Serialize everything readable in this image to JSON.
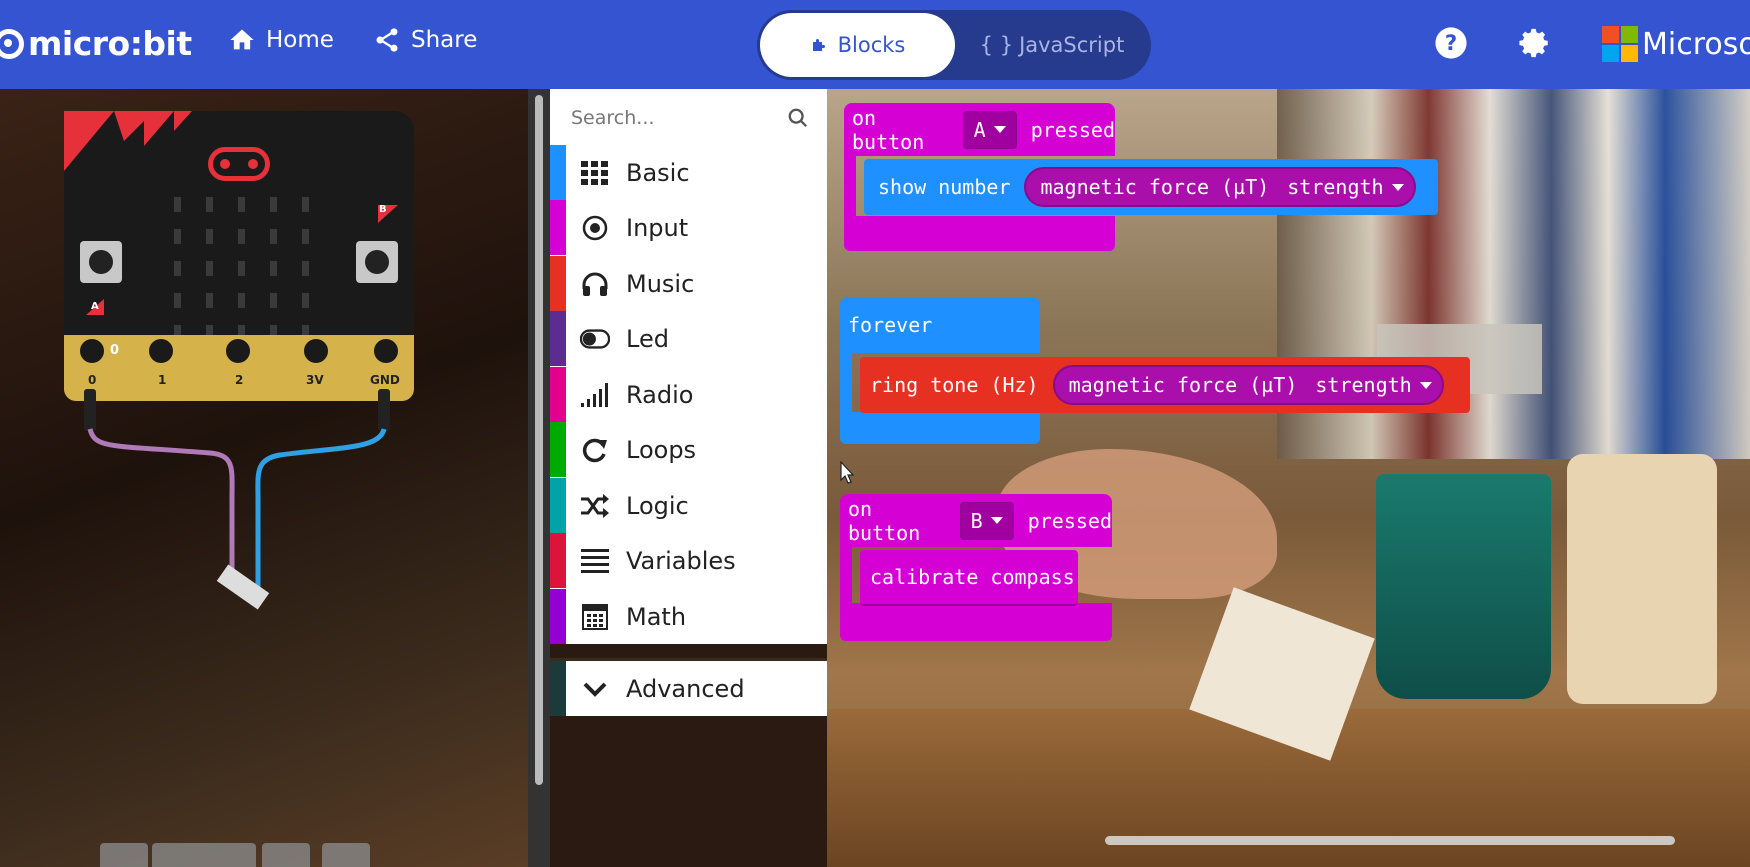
{
  "header": {
    "logo_text": "micro:bit",
    "home_label": "Home",
    "share_label": "Share",
    "blocks_label": "Blocks",
    "javascript_label": "JavaScript",
    "microsoft_label": "Microsoft",
    "icons": [
      "home-icon",
      "share-icon",
      "puzzle-icon",
      "code-braces-icon",
      "help-icon",
      "gear-icon",
      "microsoft-logo"
    ],
    "brand_color": "#3454d1"
  },
  "simulator": {
    "pins": [
      "0",
      "1",
      "2",
      "3V",
      "GND"
    ],
    "pin_marker": "0",
    "button_a": "A",
    "button_b": "B"
  },
  "toolbox": {
    "search_placeholder": "Search...",
    "categories": [
      {
        "label": "Basic",
        "color": "#1e90ff",
        "icon": "grid-icon"
      },
      {
        "label": "Input",
        "color": "#d400d4",
        "icon": "target-icon"
      },
      {
        "label": "Music",
        "color": "#e63022",
        "icon": "headphones-icon"
      },
      {
        "label": "Led",
        "color": "#5c2d91",
        "icon": "toggle-icon"
      },
      {
        "label": "Radio",
        "color": "#e3008c",
        "icon": "signal-icon"
      },
      {
        "label": "Loops",
        "color": "#00aa00",
        "icon": "loop-icon"
      },
      {
        "label": "Logic",
        "color": "#00a4a6",
        "icon": "shuffle-icon"
      },
      {
        "label": "Variables",
        "color": "#dc143c",
        "icon": "lines-icon"
      },
      {
        "label": "Math",
        "color": "#9400d3",
        "icon": "calculator-icon"
      }
    ],
    "advanced_label": "Advanced"
  },
  "workspace": {
    "block1": {
      "on": "on button",
      "button": "A",
      "pressed": "pressed",
      "stmt": "show number",
      "sensor": "magnetic force (µT)",
      "axis": "strength"
    },
    "block2": {
      "hat": "forever",
      "stmt": "ring tone (Hz)",
      "sensor": "magnetic force (µT)",
      "axis": "strength"
    },
    "block3": {
      "on": "on button",
      "button": "B",
      "pressed": "pressed",
      "stmt": "calibrate compass"
    },
    "colors": {
      "input": "#d400d4",
      "basic": "#1e90ff",
      "music": "#e63022"
    }
  }
}
